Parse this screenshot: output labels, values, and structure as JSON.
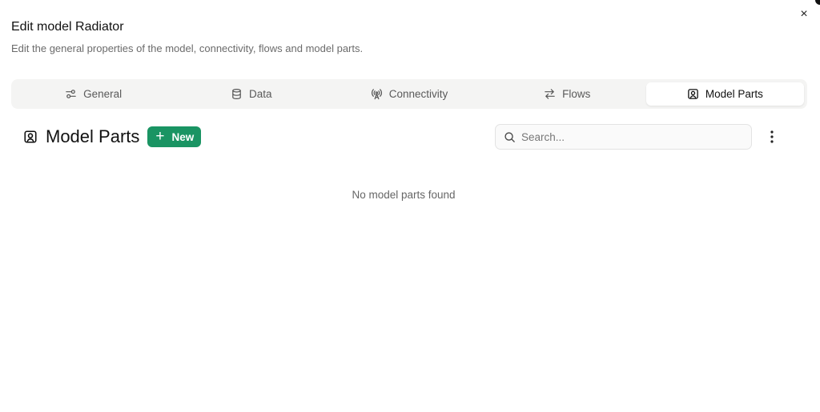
{
  "dialog": {
    "title": "Edit model Radiator",
    "subtitle": "Edit the general properties of the model, connectivity, flows and model parts.",
    "close_glyph": "×"
  },
  "tabs": [
    {
      "label": "General",
      "icon": "sliders-icon",
      "active": false
    },
    {
      "label": "Data",
      "icon": "database-icon",
      "active": false
    },
    {
      "label": "Connectivity",
      "icon": "broadcast-icon",
      "active": false
    },
    {
      "label": "Flows",
      "icon": "arrows-left-right-icon",
      "active": false
    },
    {
      "label": "Model Parts",
      "icon": "user-square-icon",
      "active": true
    }
  ],
  "section": {
    "title": "Model Parts",
    "icon": "user-square-icon",
    "new_button": {
      "glyph": "+",
      "label": "New"
    }
  },
  "search": {
    "placeholder": "Search...",
    "value": ""
  },
  "empty_state": "No model parts found",
  "colors": {
    "accent": "#1a9463",
    "tab_bar_bg": "#f4f4f3",
    "muted_text": "#6b6b6b"
  }
}
